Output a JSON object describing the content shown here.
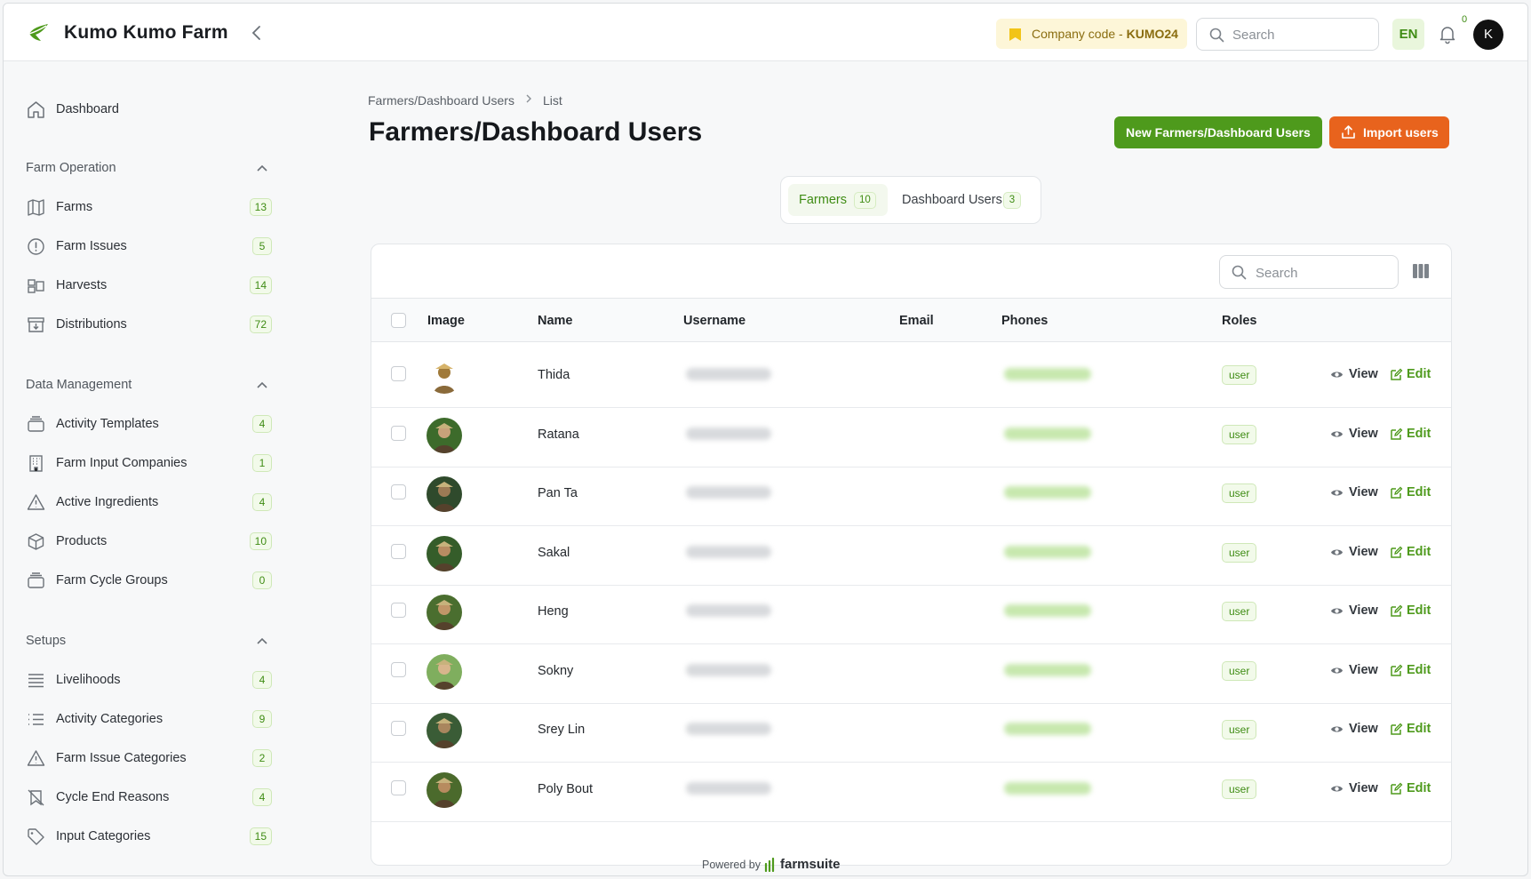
{
  "app": {
    "name": "Kumo Kumo Farm"
  },
  "topbar": {
    "company_code_label": "Company code - ",
    "company_code": "KUMO24",
    "search_placeholder": "Search",
    "language": "EN",
    "notification_count": "0",
    "avatar_initial": "K"
  },
  "sidebar": {
    "dashboard": "Dashboard",
    "sections": [
      {
        "title": "Farm Operation",
        "items": [
          {
            "label": "Farms",
            "count": "13",
            "icon": "map-icon"
          },
          {
            "label": "Farm Issues",
            "count": "5",
            "icon": "alert-circle-icon"
          },
          {
            "label": "Harvests",
            "count": "14",
            "icon": "harvest-icon"
          },
          {
            "label": "Distributions",
            "count": "72",
            "icon": "archive-down-icon"
          }
        ]
      },
      {
        "title": "Data Management",
        "items": [
          {
            "label": "Activity Templates",
            "count": "4",
            "icon": "stack-icon"
          },
          {
            "label": "Farm Input Companies",
            "count": "1",
            "icon": "building-icon"
          },
          {
            "label": "Active Ingredients",
            "count": "4",
            "icon": "warning-triangle-icon"
          },
          {
            "label": "Products",
            "count": "10",
            "icon": "cube-icon"
          },
          {
            "label": "Farm Cycle Groups",
            "count": "0",
            "icon": "stack-icon"
          }
        ]
      },
      {
        "title": "Setups",
        "items": [
          {
            "label": "Livelihoods",
            "count": "4",
            "icon": "list-lines-icon"
          },
          {
            "label": "Activity Categories",
            "count": "9",
            "icon": "bullet-list-icon"
          },
          {
            "label": "Farm Issue Categories",
            "count": "2",
            "icon": "warning-triangle-icon"
          },
          {
            "label": "Cycle End Reasons",
            "count": "4",
            "icon": "no-bookmark-icon"
          },
          {
            "label": "Input Categories",
            "count": "15",
            "icon": "tag-icon"
          }
        ]
      }
    ]
  },
  "breadcrumb": {
    "parent": "Farmers/Dashboard Users",
    "current": "List"
  },
  "page": {
    "title": "Farmers/Dashboard Users",
    "new_button": "New Farmers/Dashboard Users",
    "import_button": "Import users"
  },
  "tabs": [
    {
      "label": "Farmers",
      "count": "10",
      "active": true
    },
    {
      "label": "Dashboard Users",
      "count": "3",
      "active": false
    }
  ],
  "table": {
    "search_placeholder": "Search",
    "columns": [
      "Image",
      "Name",
      "Username",
      "Email",
      "Phones",
      "Roles"
    ],
    "view_label": "View",
    "edit_label": "Edit",
    "rows": [
      {
        "name": "Thida",
        "role": "user"
      },
      {
        "name": "Ratana",
        "role": "user"
      },
      {
        "name": "Pan Ta",
        "role": "user"
      },
      {
        "name": "Sakal",
        "role": "user"
      },
      {
        "name": "Heng",
        "role": "user"
      },
      {
        "name": "Sokny",
        "role": "user"
      },
      {
        "name": "Srey Lin",
        "role": "user"
      },
      {
        "name": "Poly Bout",
        "role": "user"
      }
    ]
  },
  "footer": {
    "powered_by": "Powered by",
    "brand": "farmsuite"
  },
  "colors": {
    "accent": "#4e9a1c",
    "import": "#e8631d",
    "badge_bg": "#f2faea"
  }
}
